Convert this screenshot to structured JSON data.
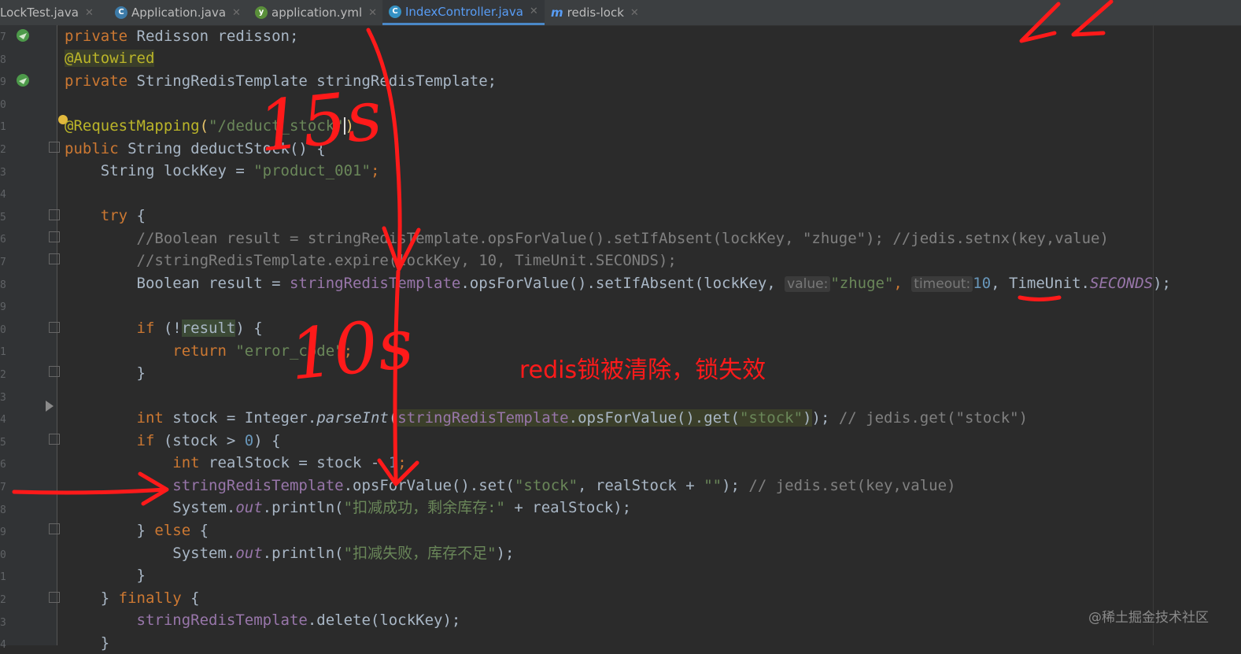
{
  "tabs": [
    {
      "label": "LockTest.java",
      "icon": "java-class-icon",
      "active": false
    },
    {
      "label": "Application.java",
      "icon": "spring-app-icon",
      "active": false
    },
    {
      "label": "application.yml",
      "icon": "yaml-file-icon",
      "active": false
    },
    {
      "label": "IndexController.java",
      "icon": "class-c-icon",
      "active": true
    },
    {
      "label": "redis-lock",
      "icon": "module-m-icon",
      "active": false
    }
  ],
  "code": {
    "l1": {
      "a": "private ",
      "b": "Redisson redisson;"
    },
    "l2": {
      "a": "@Autowired"
    },
    "l3": {
      "a": "private ",
      "b": "StringRedisTemplate stringRedisTemplate;"
    },
    "l4": {
      "a": "@RequestMapping",
      "b": "(",
      "c": "\"/deduct_stock\"",
      "d": ")"
    },
    "l5": {
      "a": "public ",
      "b": "String deductStock() {"
    },
    "l6": {
      "a": "    String lockKey = ",
      "b": "\"product_001\"",
      "c": ";"
    },
    "l7": {
      "a": "    try",
      "b": " {"
    },
    "l8": {
      "a": "        //Boolean result = stringRedisTemplate.opsForValue().setIfAbsent(lockKey, \"zhuge\"); //jedis.setnx(key,value)"
    },
    "l9": {
      "a": "        //stringRedisTemplate.expire(lockKey, 10, TimeUnit.SECONDS);"
    },
    "l10": {
      "a": "        Boolean result = ",
      "b": "stringRedisTemplate",
      "c": ".opsForValue().setIfAbsent(lockKey, ",
      "h1": "value:",
      "d": "\"zhuge\"",
      "e": ", ",
      "h2": "timeout:",
      "f": "10",
      "g": ", TimeUnit.",
      "i": "SECONDS",
      "j": ");"
    },
    "l11": {
      "a": "        if",
      "b": " (!",
      "c": "result",
      "d": ") {"
    },
    "l12": {
      "a": "            return ",
      "b": "\"error_code\"",
      "c": ";"
    },
    "l13": {
      "a": "        }"
    },
    "l14": {
      "a": "        int ",
      "b": "stock = Integer.",
      "c": "parseInt",
      "d": "(",
      "e": "stringRedisTemplate",
      "f": ".opsForValue().get(",
      "g": "\"stock\"",
      "h": ")",
      "i": "); ",
      "j": "// jedis.get(\"stock\")"
    },
    "l15": {
      "a": "        if",
      "b": " (stock > ",
      "c": "0",
      "d": ") {"
    },
    "l16": {
      "a": "            int ",
      "b": "realStock = stock - ",
      "c": "1",
      "d": ";"
    },
    "l17": {
      "a": "            stringRedisTemplate",
      "b": ".opsForValue().set(",
      "c": "\"stock\"",
      "d": ", realStock + ",
      "e": "\"\"",
      "f": "); ",
      "g": "// jedis.set(key,value)"
    },
    "l18": {
      "a": "            System.",
      "b": "out",
      "c": ".println(",
      "d": "\"扣减成功，剩余库存:\"",
      "e": " + realStock);"
    },
    "l19": {
      "a": "        } ",
      "b": "else",
      "c": " {"
    },
    "l20": {
      "a": "            System.",
      "b": "out",
      "c": ".println(",
      "d": "\"扣减失败，库存不足\"",
      "e": ");"
    },
    "l21": {
      "a": "        }"
    },
    "l22": {
      "a": "    } ",
      "b": "finally",
      "c": " {"
    },
    "l23": {
      "a": "        stringRedisTemplate",
      "b": ".delete(lockKey);"
    },
    "l24": {
      "a": "    }"
    }
  },
  "line_numbers": [
    "7",
    "8",
    "9",
    "0",
    "1",
    "2",
    "3",
    "4",
    "5",
    "6",
    "7",
    "8",
    "9",
    "0",
    "1",
    "2",
    "3",
    "4",
    "5",
    "6",
    "7",
    "8",
    "9",
    "0",
    "1",
    "2",
    "3",
    "4"
  ],
  "annotations": {
    "time_a": "15s",
    "time_b": "10s",
    "note": "redis锁被清除，锁失效"
  },
  "watermark": "@稀土掘金技术社区",
  "colors": {
    "background": "#2b2b2b",
    "keyword": "#cc7832",
    "string": "#6a8759",
    "annotation_red": "#ff1a1a"
  }
}
